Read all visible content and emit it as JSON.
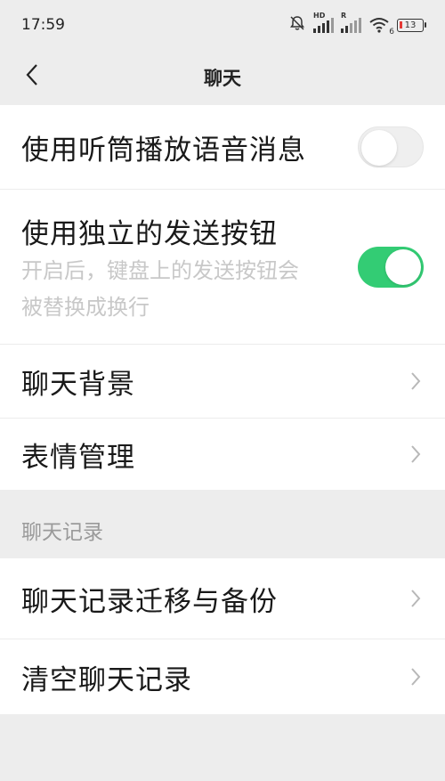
{
  "status_bar": {
    "time": "17:59",
    "battery_level": "13",
    "signal1_tag": "HD",
    "signal2_tag": "R",
    "wifi_tag": "6",
    "icons": [
      "mute-bell-icon",
      "signal-icon",
      "signal-icon",
      "wifi-icon",
      "battery-icon"
    ]
  },
  "nav": {
    "title": "聊天",
    "back_icon": "chevron-left-icon"
  },
  "settings": {
    "use_receiver": {
      "label": "使用听筒播放语音消息",
      "enabled": false
    },
    "send_button": {
      "label": "使用独立的发送按钮",
      "sub_line1": "开启后，键盘上的发送按钮会",
      "sub_line2": "被替换成换行",
      "enabled": true
    },
    "chat_background": {
      "label": "聊天背景"
    },
    "sticker_manage": {
      "label": "表情管理"
    }
  },
  "history_section": {
    "header": "聊天记录",
    "migrate_backup": {
      "label": "聊天记录迁移与备份"
    },
    "clear_history": {
      "label": "清空聊天记录"
    }
  },
  "colors": {
    "toggle_on": "#33cc74",
    "background": "#ededed",
    "card": "#ffffff"
  }
}
